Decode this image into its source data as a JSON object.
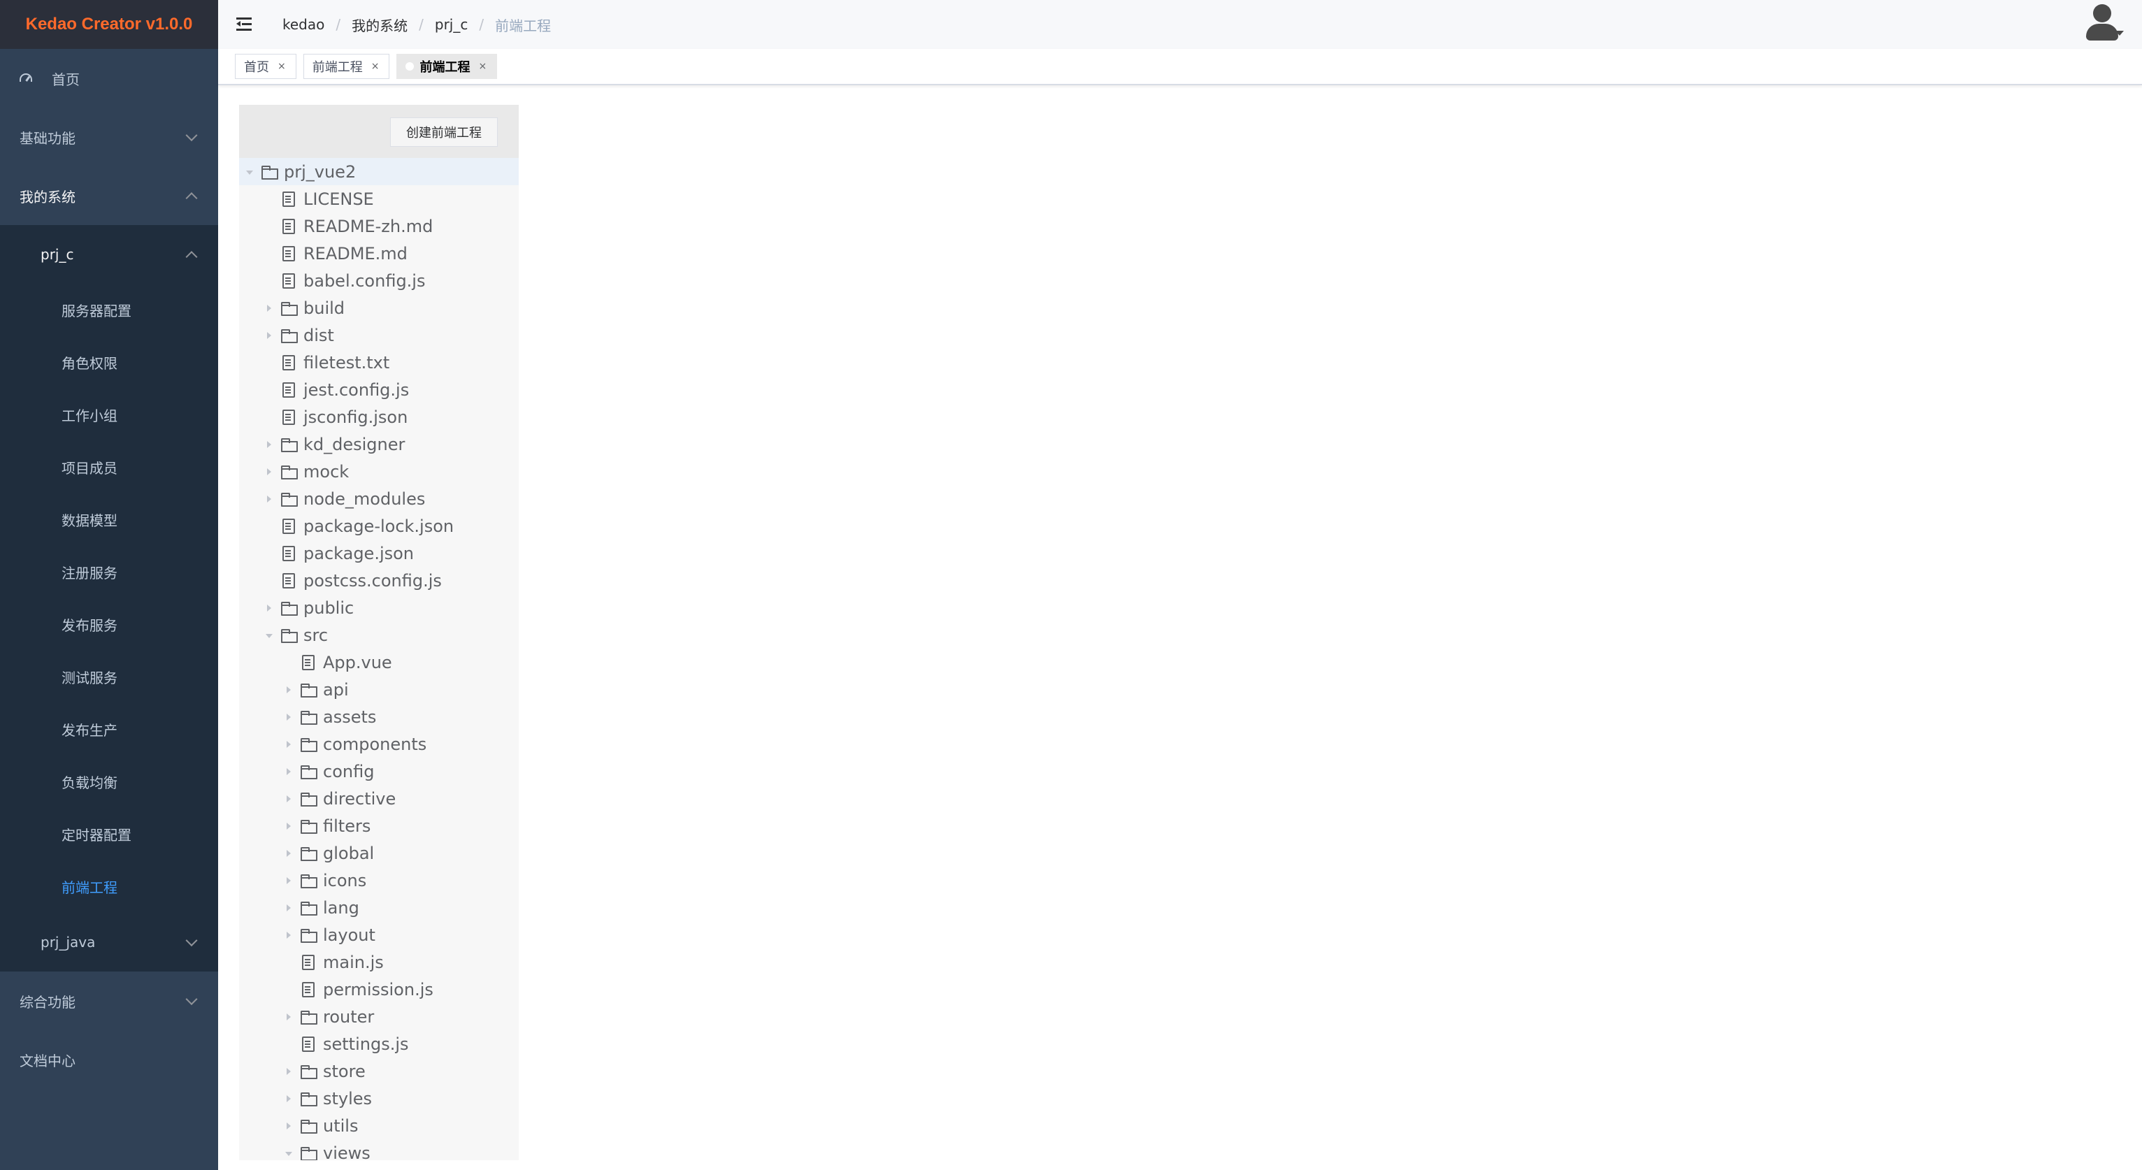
{
  "app": {
    "title": "Kedao Creator v1.0.0"
  },
  "sidebar": {
    "home": "首页",
    "basic": "基础功能",
    "my_system": "我的系统",
    "prj_c": "prj_c",
    "prj_c_items": [
      "服务器配置",
      "角色权限",
      "工作小组",
      "项目成员",
      "数据模型",
      "注册服务",
      "发布服务",
      "测试服务",
      "发布生产",
      "负载均衡",
      "定时器配置",
      "前端工程"
    ],
    "active_item": "前端工程",
    "prj_java": "prj_java",
    "integrated": "综合功能",
    "docs": "文档中心"
  },
  "breadcrumb": [
    "kedao",
    "我的系统",
    "prj_c",
    "前端工程"
  ],
  "tags": [
    {
      "label": "首页",
      "active": false
    },
    {
      "label": "前端工程",
      "active": false
    },
    {
      "label": "前端工程",
      "active": true
    }
  ],
  "tag_close": "×",
  "panel": {
    "create_button": "创建前端工程"
  },
  "tree": [
    {
      "name": "prj_vue2",
      "type": "folder",
      "depth": 0,
      "open": true
    },
    {
      "name": "LICENSE",
      "type": "file",
      "depth": 1
    },
    {
      "name": "README-zh.md",
      "type": "file",
      "depth": 1
    },
    {
      "name": "README.md",
      "type": "file",
      "depth": 1
    },
    {
      "name": "babel.config.js",
      "type": "file",
      "depth": 1
    },
    {
      "name": "build",
      "type": "folder",
      "depth": 1,
      "open": false
    },
    {
      "name": "dist",
      "type": "folder",
      "depth": 1,
      "open": false
    },
    {
      "name": "filetest.txt",
      "type": "file",
      "depth": 1
    },
    {
      "name": "jest.config.js",
      "type": "file",
      "depth": 1
    },
    {
      "name": "jsconfig.json",
      "type": "file",
      "depth": 1
    },
    {
      "name": "kd_designer",
      "type": "folder",
      "depth": 1,
      "open": false
    },
    {
      "name": "mock",
      "type": "folder",
      "depth": 1,
      "open": false
    },
    {
      "name": "node_modules",
      "type": "folder",
      "depth": 1,
      "open": false
    },
    {
      "name": "package-lock.json",
      "type": "file",
      "depth": 1
    },
    {
      "name": "package.json",
      "type": "file",
      "depth": 1
    },
    {
      "name": "postcss.config.js",
      "type": "file",
      "depth": 1
    },
    {
      "name": "public",
      "type": "folder",
      "depth": 1,
      "open": false
    },
    {
      "name": "src",
      "type": "folder",
      "depth": 1,
      "open": true
    },
    {
      "name": "App.vue",
      "type": "file",
      "depth": 2
    },
    {
      "name": "api",
      "type": "folder",
      "depth": 2,
      "open": false
    },
    {
      "name": "assets",
      "type": "folder",
      "depth": 2,
      "open": false
    },
    {
      "name": "components",
      "type": "folder",
      "depth": 2,
      "open": false
    },
    {
      "name": "config",
      "type": "folder",
      "depth": 2,
      "open": false
    },
    {
      "name": "directive",
      "type": "folder",
      "depth": 2,
      "open": false
    },
    {
      "name": "filters",
      "type": "folder",
      "depth": 2,
      "open": false
    },
    {
      "name": "global",
      "type": "folder",
      "depth": 2,
      "open": false
    },
    {
      "name": "icons",
      "type": "folder",
      "depth": 2,
      "open": false
    },
    {
      "name": "lang",
      "type": "folder",
      "depth": 2,
      "open": false
    },
    {
      "name": "layout",
      "type": "folder",
      "depth": 2,
      "open": false
    },
    {
      "name": "main.js",
      "type": "file",
      "depth": 2
    },
    {
      "name": "permission.js",
      "type": "file",
      "depth": 2
    },
    {
      "name": "router",
      "type": "folder",
      "depth": 2,
      "open": false
    },
    {
      "name": "settings.js",
      "type": "file",
      "depth": 2
    },
    {
      "name": "store",
      "type": "folder",
      "depth": 2,
      "open": false
    },
    {
      "name": "styles",
      "type": "folder",
      "depth": 2,
      "open": false
    },
    {
      "name": "utils",
      "type": "folder",
      "depth": 2,
      "open": false
    },
    {
      "name": "views",
      "type": "folder",
      "depth": 2,
      "open": true
    }
  ],
  "colors": {
    "sidebar_bg": "#304156",
    "submenu_bg": "#1f2d3d",
    "active": "#409eff",
    "logo": "#ff6a2b"
  }
}
